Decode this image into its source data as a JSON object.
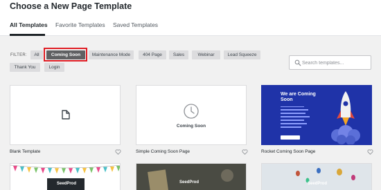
{
  "header": {
    "title": "Choose a New Page Template",
    "tabs": [
      "All Templates",
      "Favorite Templates",
      "Saved Templates"
    ]
  },
  "filter": {
    "label": "FILTER:",
    "chips": [
      "All",
      "Coming Soon",
      "Maintenance Mode",
      "404 Page",
      "Sales",
      "Webinar",
      "Lead Squeeze",
      "Thank You",
      "Login"
    ],
    "active": "Coming Soon"
  },
  "search": {
    "placeholder": "Search templates..."
  },
  "cards": [
    {
      "title": "Blank Template"
    },
    {
      "title": "Simple Coming Soon Page",
      "preview_text": "Coming Soon"
    },
    {
      "title": "Rocket Coming Soon Page",
      "preview_heading": "We are Coming Soon"
    }
  ],
  "bottom_cards_logo": "SeedProd",
  "colors": {
    "highlight": "#e01b22",
    "active_chip": "#5f6062",
    "rocket_bg": "#1f33a8"
  }
}
